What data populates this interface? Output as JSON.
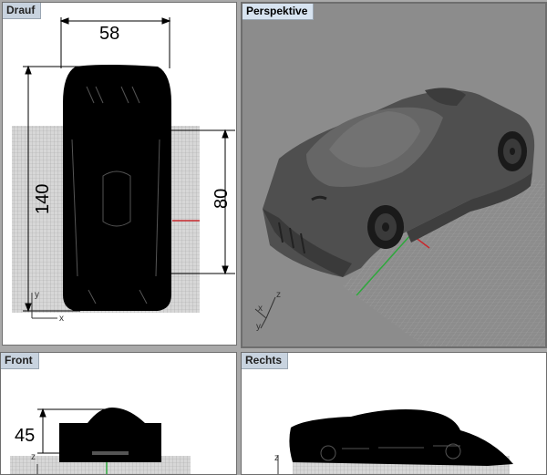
{
  "viewports": {
    "top": {
      "label": "Drauf"
    },
    "persp": {
      "label": "Perspektive"
    },
    "front": {
      "label": "Front"
    },
    "right": {
      "label": "Rechts"
    }
  },
  "dimensions": {
    "width": "58",
    "length": "140",
    "wheelbase": "80",
    "height": "45"
  },
  "axes": {
    "x": "x",
    "y": "y",
    "z": "z"
  },
  "colors": {
    "viewport_border": "#6e6e6e",
    "grid_grey": "#b9b9b9",
    "axis_red": "#c8282d",
    "axis_green": "#2ea83c",
    "car_body": "#555555"
  }
}
